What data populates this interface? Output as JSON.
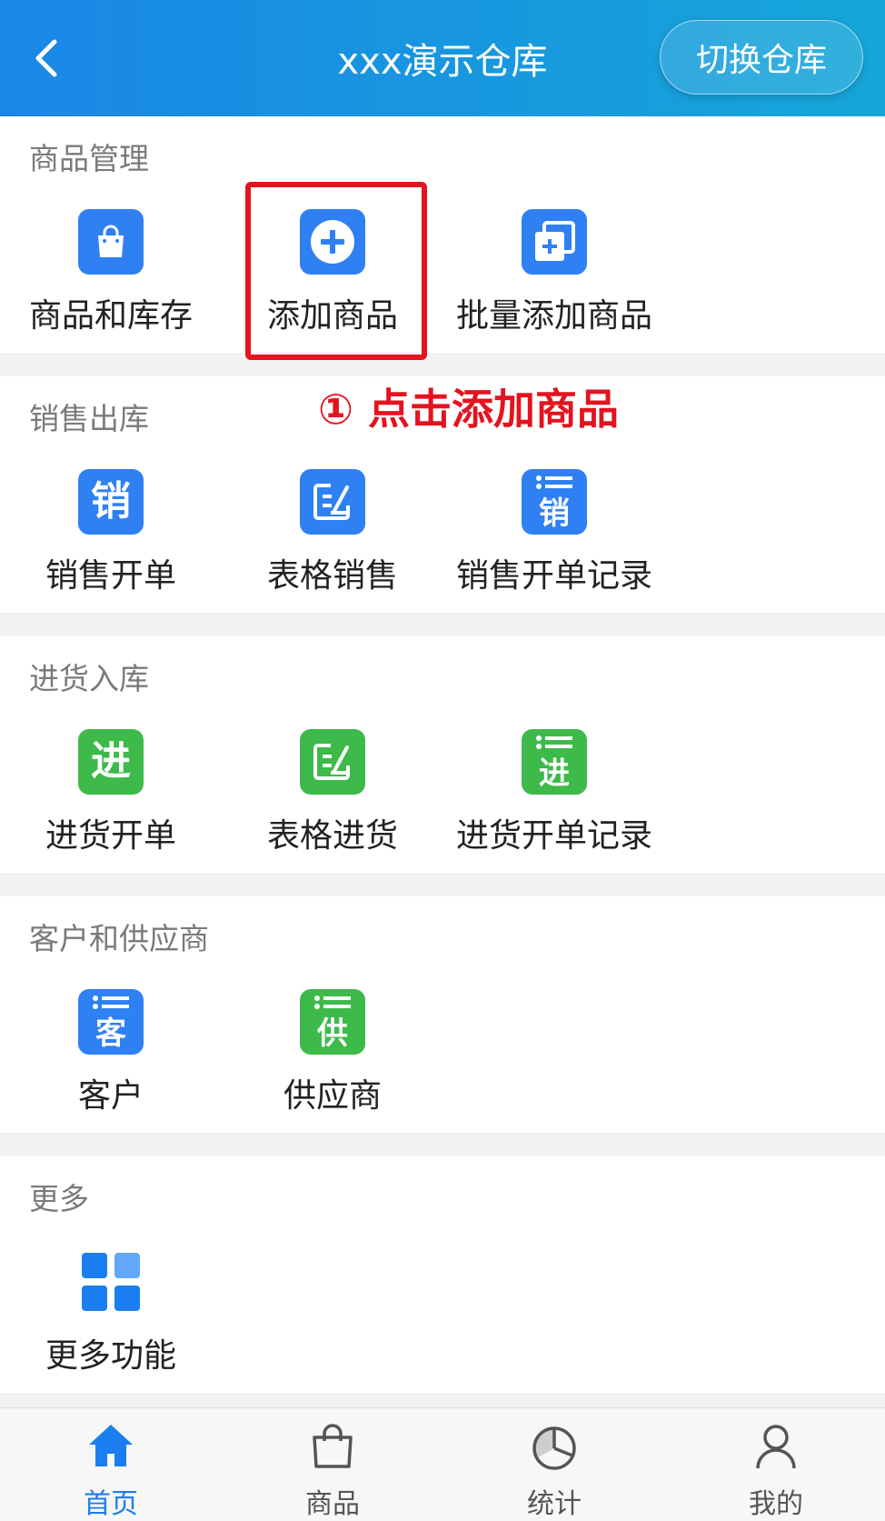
{
  "header": {
    "title": "xxx演示仓库",
    "switch_button": "切换仓库"
  },
  "sections": {
    "goods": {
      "title": "商品管理",
      "items": [
        "商品和库存",
        "添加商品",
        "批量添加商品"
      ]
    },
    "sales": {
      "title": "销售出库",
      "items": [
        "销售开单",
        "表格销售",
        "销售开单记录"
      ],
      "glyphs": [
        "销",
        "销"
      ]
    },
    "purchase": {
      "title": "进货入库",
      "items": [
        "进货开单",
        "表格进货",
        "进货开单记录"
      ],
      "glyphs": [
        "进",
        "进"
      ]
    },
    "partners": {
      "title": "客户和供应商",
      "items": [
        "客户",
        "供应商"
      ],
      "glyphs": [
        "客",
        "供"
      ]
    },
    "more": {
      "title": "更多",
      "items": [
        "更多功能"
      ]
    }
  },
  "annotation": "① 点击添加商品",
  "tabbar": {
    "tabs": [
      "首页",
      "商品",
      "统计",
      "我的"
    ],
    "active": "首页"
  },
  "colors": {
    "header_start": "#1a86e6",
    "header_end": "#16a6d8",
    "blue_icon": "#2f80f2",
    "green_icon": "#3dba4a",
    "highlight_red": "#e3131f",
    "active_tab": "#1a7ef0"
  }
}
